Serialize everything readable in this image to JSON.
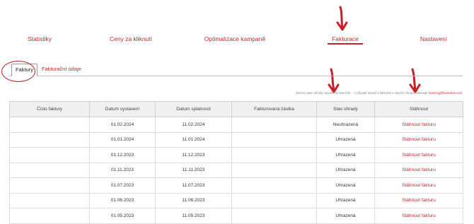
{
  "nav": {
    "items": [
      {
        "label": "Statistiky"
      },
      {
        "label": "Ceny za kliknutí"
      },
      {
        "label": "Optimalizace kampaně"
      },
      {
        "label": "Fakturace",
        "active": true
      },
      {
        "label": "Nastavení"
      }
    ]
  },
  "tabs": [
    {
      "label": "Faktury",
      "active": true
    },
    {
      "label": "Fakturační údaje"
    }
  ],
  "note": {
    "text": "Změna stavu úhrady nepodléhá okamžitě… V případě dotazů k fakturám a stavům úhrad kontaktujte",
    "email": "invoicing@favionline.com"
  },
  "table": {
    "headers": [
      "Číslo faktury",
      "Datum vystavení",
      "Datum splatnosti",
      "Fakturovaná částka",
      "Stav úhrady",
      "Stáhnout"
    ],
    "rows": [
      {
        "number": "",
        "issued": "01.02.2024",
        "due": "11.02.2024",
        "amount": "",
        "status": "Neuhrazená",
        "download": "Stáhnout fakturu"
      },
      {
        "number": "",
        "issued": "01.01.2024",
        "due": "11.01.2024",
        "amount": "",
        "status": "Uhrazená",
        "download": "Stáhnout fakturu"
      },
      {
        "number": "",
        "issued": "01.12.2023",
        "due": "11.12.2023",
        "amount": "",
        "status": "Uhrazená",
        "download": "Stáhnout fakturu"
      },
      {
        "number": "",
        "issued": "01.11.2023",
        "due": "11.11.2023",
        "amount": "",
        "status": "Uhrazená",
        "download": "Stáhnout fakturu"
      },
      {
        "number": "",
        "issued": "01.07.2023",
        "due": "11.07.2023",
        "amount": "",
        "status": "Uhrazená",
        "download": "Stáhnout fakturu"
      },
      {
        "number": "",
        "issued": "01.06.2023",
        "due": "11.06.2023",
        "amount": "",
        "status": "Uhrazená",
        "download": "Stáhnout fakturu"
      },
      {
        "number": "",
        "issued": "01.05.2023",
        "due": "11.05.2023",
        "amount": "",
        "status": "Uhrazená",
        "download": "Stáhnout fakturu"
      }
    ]
  },
  "colors": {
    "accent": "#c0282e",
    "annotation": "#c62026"
  }
}
